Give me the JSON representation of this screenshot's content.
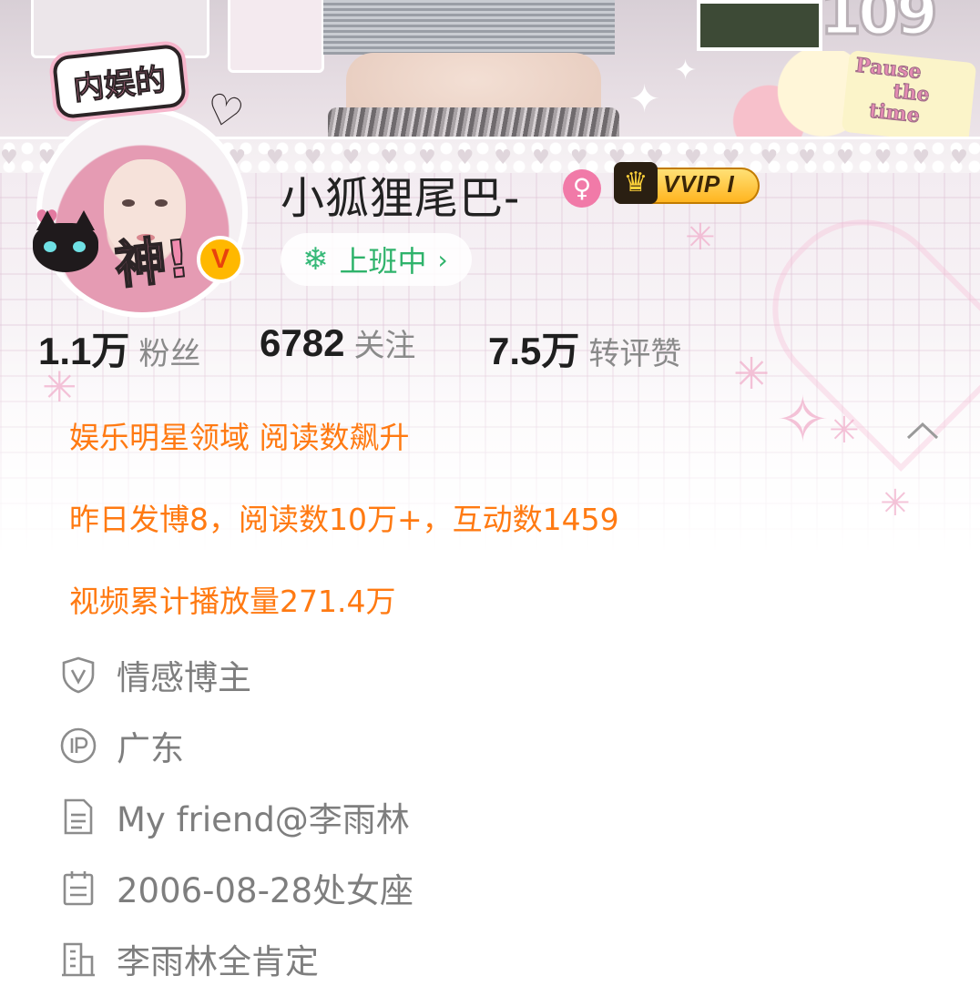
{
  "banner": {
    "pause_text_lines": [
      "Pause",
      "the",
      "time"
    ],
    "big_number": "109"
  },
  "avatar": {
    "frame_title": "内娱的",
    "frame_caption": "神!",
    "verified_badge": "V"
  },
  "profile": {
    "username": "小狐狸尾巴-",
    "gender_symbol": "♀",
    "vip_badge": "VVIP",
    "vip_level": "I",
    "status": "上班中",
    "status_chevron": "›"
  },
  "stats": [
    {
      "value": "1.1万",
      "label": "粉丝"
    },
    {
      "value": "6782",
      "label": "关注"
    },
    {
      "value": "7.5万",
      "label": "转评赞"
    }
  ],
  "highlights": {
    "domain": "娱乐明星领域 阅读数飙升",
    "yesterday": "昨日发博8，阅读数10万+，互动数1459",
    "video": "视频累计播放量271.4万"
  },
  "info": [
    {
      "icon": "shield-v-icon",
      "text": "情感博主"
    },
    {
      "icon": "ip-location-icon",
      "text": "广东"
    },
    {
      "icon": "document-icon",
      "text": "My friend@李雨林"
    },
    {
      "icon": "calendar-icon",
      "text": "2006-08-28处女座"
    },
    {
      "icon": "building-icon",
      "text": "李雨林全肯定"
    }
  ],
  "colors": {
    "accent_orange": "#ff7a12",
    "status_green": "#2fb36b",
    "gender_pink": "#f17aa8",
    "vip_gold": "#ffb21b"
  }
}
